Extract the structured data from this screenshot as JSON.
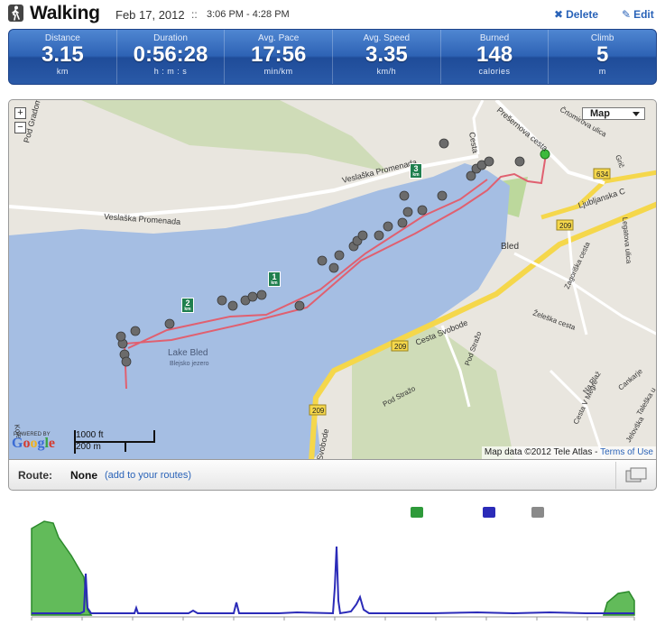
{
  "activity": {
    "type": "Walking",
    "date": "Feb 17, 2012",
    "separator": "::",
    "time_range": "3:06 PM - 4:28 PM",
    "actions": {
      "delete": "Delete",
      "edit": "Edit"
    }
  },
  "stats": [
    {
      "label": "Distance",
      "value": "3.15",
      "unit": "km"
    },
    {
      "label": "Duration",
      "value": "0:56:28",
      "unit": "h : m : s"
    },
    {
      "label": "Avg. Pace",
      "value": "17:56",
      "unit": "min/km"
    },
    {
      "label": "Avg. Speed",
      "value": "3.35",
      "unit": "km/h"
    },
    {
      "label": "Burned",
      "value": "148",
      "unit": "calories"
    },
    {
      "label": "Climb",
      "value": "5",
      "unit": "m"
    }
  ],
  "map": {
    "zoom_in": "+",
    "zoom_out": "−",
    "type_selector": "Map",
    "labels": {
      "lake": "Lake Bled",
      "lake_local": "Blejsko jezero",
      "town": "Bled",
      "promenada_1": "Veslaška Promenada",
      "promenada_2": "Veslaška Promenada",
      "cesta_svobode_1": "Cesta Svobode",
      "cesta_svobode_2": "Svobode",
      "presernova": "Prešernova cesta",
      "ljubljanska": "Ljubljanska C",
      "zagorska": "Zagoriška cesta",
      "zeleska": "Želeška cesta",
      "pod_straza_1": "Pod Stražo",
      "pod_straza_2": "Pod Stražo",
      "cesta_v_megre": "Cesta V Megre",
      "na_plaz": "Na Plaž",
      "cankarj": "Cankarje",
      "jelovska": "Jelovška",
      "taleska": "Taleška u",
      "legatova": "Legatova ulica",
      "crtomirova": "Črtomirova ulica",
      "gric": "Grič",
      "cesta_left": "Cesta",
      "gradom": "Pod Gradom",
      "kolo": "Kole",
      "road_634": "634",
      "road_209a": "209",
      "road_209b": "209",
      "road_209c": "209"
    },
    "km_markers": [
      {
        "num": "1",
        "unit": "km"
      },
      {
        "num": "2",
        "unit": "km"
      },
      {
        "num": "3",
        "unit": "km"
      }
    ],
    "attribution": "Map data ©2012 Tele Atlas",
    "terms": "Terms of Use",
    "scale_ft": "1000 ft",
    "scale_m": "200 m",
    "powered_by": "POWERED BY",
    "google": "Google"
  },
  "route": {
    "label": "Route:",
    "name": "None",
    "link": "(add to your routes)"
  },
  "graph": {
    "legend_colors": [
      "#2e9a3a",
      "#2b2bb8",
      "#8a8a8a"
    ]
  },
  "colors": {
    "accent": "#2a63b8",
    "stats_bar": "#2e63b5",
    "track": "#e06070",
    "marker": "#1f7f4e",
    "elevation_fill": "#62bb5a",
    "speed_line": "#2b2bb8"
  }
}
